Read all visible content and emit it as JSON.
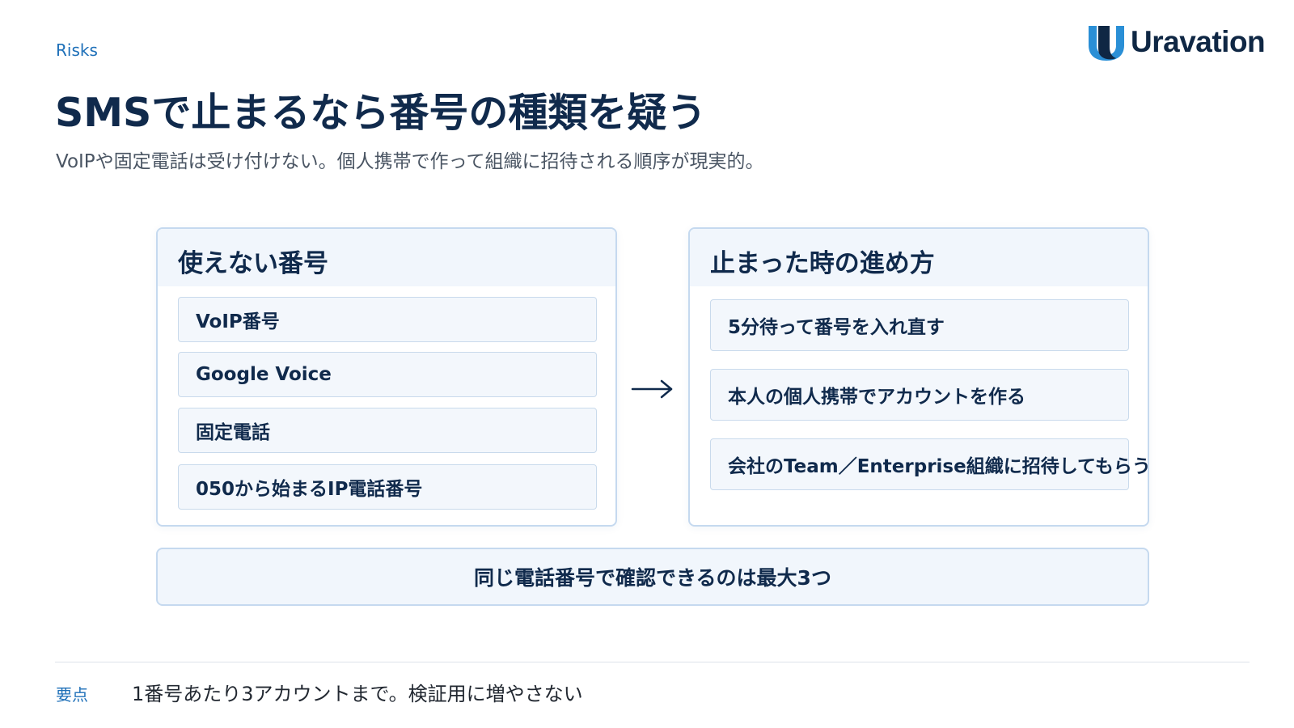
{
  "header": {
    "section_tag": "Risks",
    "title": "SMSで止まるなら番号の種類を疑う",
    "subtitle": "VoIPや固定電話は受け付けない。個人携帯で作って組織に招待される順序が現実的。"
  },
  "logo": {
    "text": "Uravation",
    "icon": "uravation-u-logo-icon",
    "colors": {
      "primary": "#0f2744",
      "accent": "#2a8fd6"
    }
  },
  "unusable_numbers": {
    "heading": "使えない番号",
    "items": [
      "VoIP番号",
      "Google Voice",
      "固定電話",
      "050から始まるIP電話番号"
    ]
  },
  "arrow_icon": "right-arrow-icon",
  "when_stuck": {
    "heading": "止まった時の進め方",
    "items": [
      "5分待って番号を入れ直す",
      "本人の個人携帯でアカウントを作る",
      "会社のTeam／Enterprise組織に招待してもらう"
    ]
  },
  "note": "同じ電話番号で確認できるのは最大3つ",
  "key_point": {
    "label": "要点",
    "text": "1番号あたり3アカウントまで。検証用に増やさない"
  },
  "colors": {
    "heading": "#102a4c",
    "accent_blue": "#1d6fb8",
    "card_border": "#c5d9ef",
    "card_fill": "#f1f6fc"
  }
}
